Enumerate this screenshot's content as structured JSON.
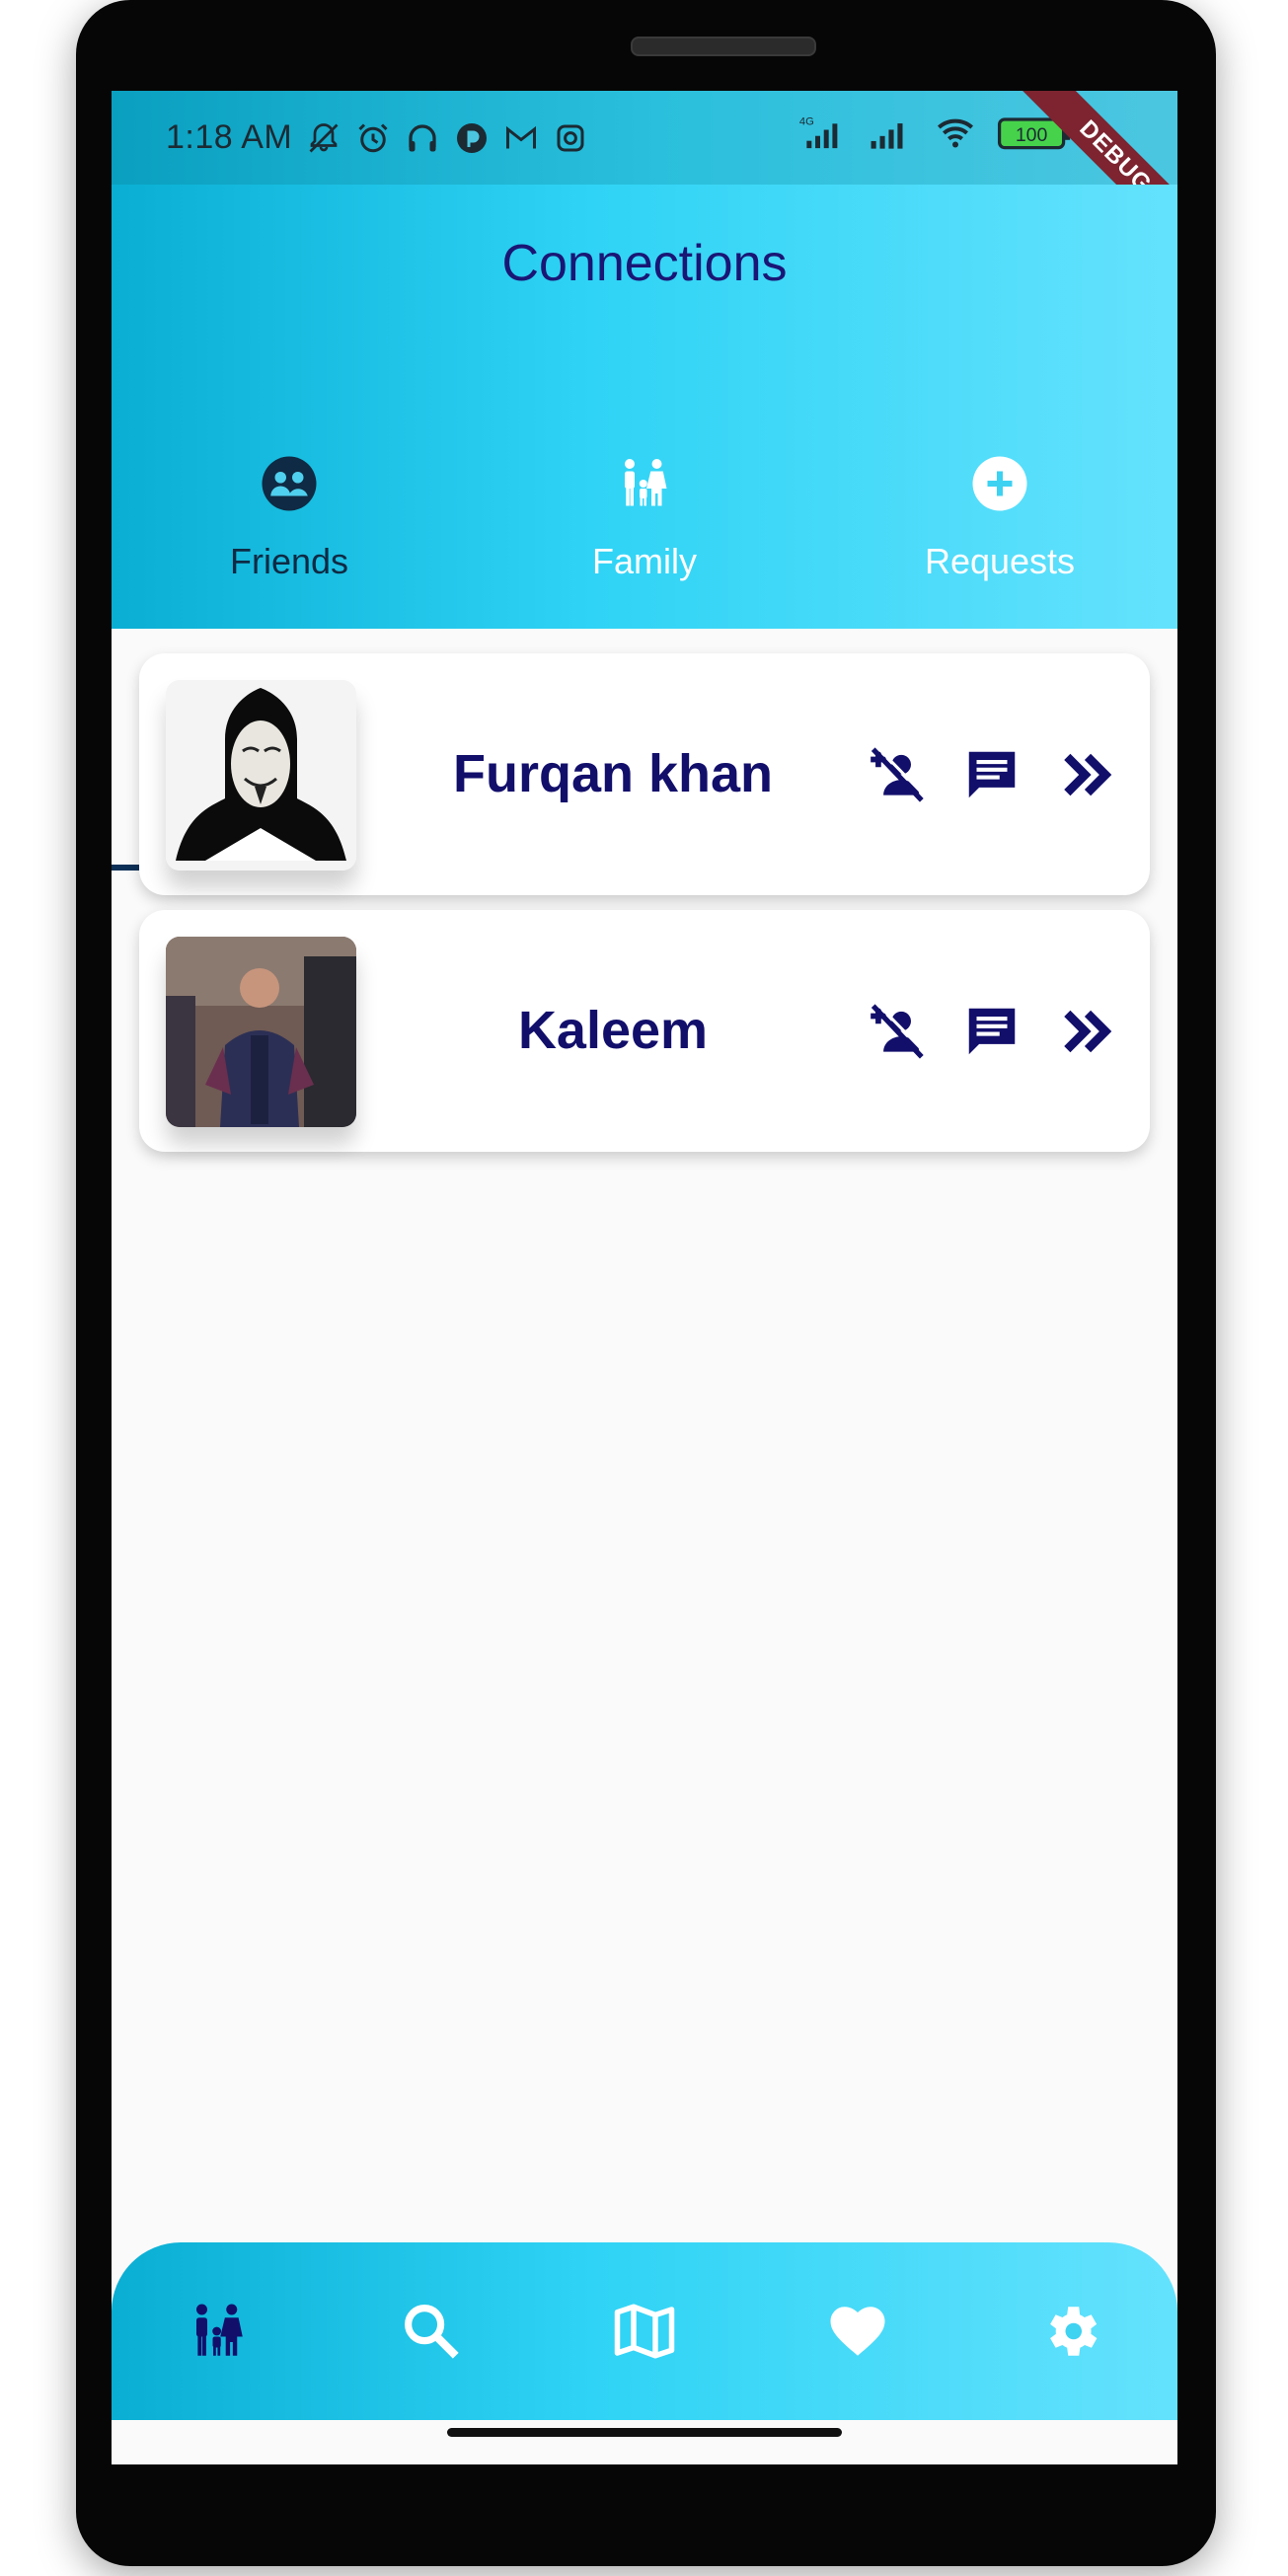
{
  "status_bar": {
    "time": "1:18 AM",
    "battery": "100",
    "debug_banner": "DEBUG",
    "network": "4G",
    "icons": [
      "bell-off-icon",
      "alarm-icon",
      "headset-icon",
      "app-icon",
      "gmail-icon",
      "instagram-icon",
      "signal-icon",
      "signal-icon",
      "wifi-icon",
      "battery-icon"
    ]
  },
  "appbar": {
    "title": "Connections",
    "tabs": [
      {
        "label": "Friends",
        "icon": "friends-icon",
        "selected": true
      },
      {
        "label": "Family",
        "icon": "family-icon",
        "selected": false
      },
      {
        "label": "Requests",
        "icon": "add-circle-icon",
        "selected": false
      }
    ]
  },
  "friends": [
    {
      "name": "Furqan khan",
      "avatar": "anonymous-mask-photo"
    },
    {
      "name": "Kaleem",
      "avatar": "person-photo"
    }
  ],
  "bottom_nav": {
    "items": [
      "family-icon",
      "search-icon",
      "map-icon",
      "heart-icon",
      "settings-icon"
    ],
    "active": "family-icon"
  },
  "colors": {
    "primary_text": "#120f6b",
    "gradient_start": "#0aaed3",
    "gradient_end": "#64e2fd",
    "indicator": "#0c2f57"
  }
}
